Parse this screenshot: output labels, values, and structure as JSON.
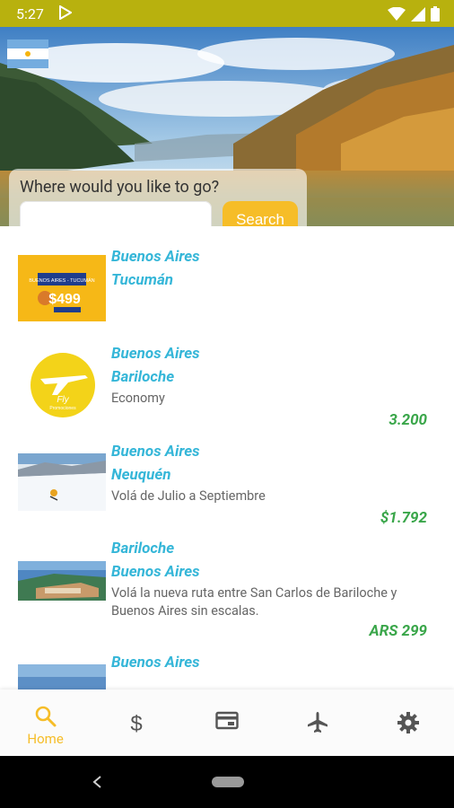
{
  "status_bar": {
    "time": "5:27"
  },
  "search": {
    "title": "Where would you like to go?",
    "placeholder": "",
    "button_label": "Search"
  },
  "promo_text": {
    "badge_top": "BUENOS AIRES - TUCUMÁN",
    "price": "$499",
    "fly_logo_word": "Fly",
    "fly_logo_sub": "Promociones"
  },
  "deals": [
    {
      "origin": "Buenos Aires",
      "destination": "Tucumán",
      "description": "",
      "price": ""
    },
    {
      "origin": "Buenos Aires",
      "destination": "Bariloche",
      "description": "Economy",
      "price": "3.200"
    },
    {
      "origin": "Buenos Aires",
      "destination": "Neuquén",
      "description": "Volá de Julio a Septiembre",
      "price": "$1.792"
    },
    {
      "origin": "Bariloche",
      "destination": "Buenos Aires",
      "description": "Volá la nueva ruta entre San Carlos de Bariloche y Buenos Aires sin escalas.",
      "price": "ARS 299"
    },
    {
      "origin": "Buenos Aires",
      "destination": "",
      "description": "",
      "price": ""
    }
  ],
  "bottom_nav": [
    {
      "label": "Home",
      "icon": "search-icon",
      "active": true
    },
    {
      "label": "",
      "icon": "dollar-icon",
      "active": false
    },
    {
      "label": "",
      "icon": "card-icon",
      "active": false
    },
    {
      "label": "",
      "icon": "airplane-icon",
      "active": false
    },
    {
      "label": "",
      "icon": "gear-icon",
      "active": false
    }
  ],
  "colors": {
    "status_bar": "#b8b10e",
    "accent": "#f6bd28",
    "city": "#35b6d8",
    "price": "#3aa64a"
  }
}
